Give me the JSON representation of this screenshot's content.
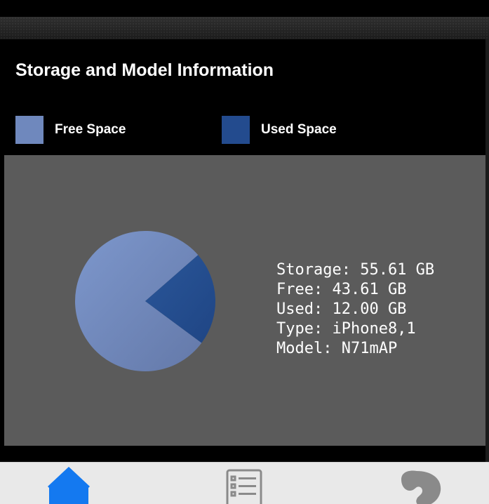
{
  "screen": {
    "title": "Storage and Model Information",
    "legend": [
      {
        "label": "Free Space",
        "color": "#6f88bd"
      },
      {
        "label": "Used Space",
        "color": "#234b8e"
      }
    ],
    "info_lines": [
      "Storage: 55.61 GB",
      "Free: 43.61 GB",
      "Used: 12.00 GB",
      "Type: iPhone8,1",
      "Model: N71mAP"
    ]
  },
  "chart_data": {
    "type": "pie",
    "labels": [
      "Free Space",
      "Used Space"
    ],
    "values": [
      43.61,
      12.0
    ],
    "unit": "GB",
    "colors": [
      "#6f88bd",
      "#234b8e"
    ]
  },
  "tab_bar": {
    "active_color": "#1479f0",
    "inactive_color": "#8a8a8a",
    "tabs": [
      {
        "icon": "house-icon",
        "active": true
      },
      {
        "icon": "list-icon",
        "active": false
      },
      {
        "icon": "ear-icon",
        "active": false
      }
    ]
  }
}
